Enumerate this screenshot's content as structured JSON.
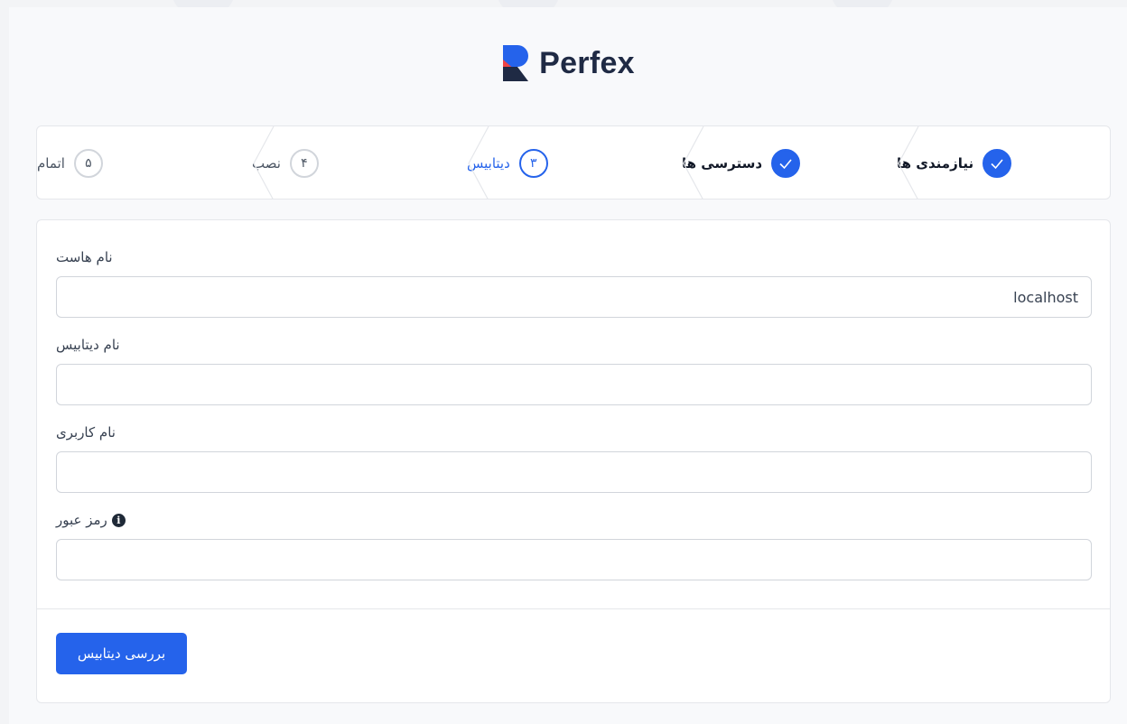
{
  "brand": {
    "name": "Perfex"
  },
  "steps": [
    {
      "number": "✓",
      "label": "نیازمندی ها",
      "state": "done"
    },
    {
      "number": "✓",
      "label": "دسترسی ها",
      "state": "done"
    },
    {
      "number": "۳",
      "label": "دیتابیس",
      "state": "active"
    },
    {
      "number": "۴",
      "label": "نصب",
      "state": "pending"
    },
    {
      "number": "۵",
      "label": "اتمام",
      "state": "pending"
    }
  ],
  "form": {
    "hostname": {
      "label": "نام هاست",
      "value": "localhost"
    },
    "database": {
      "label": "نام دیتابیس",
      "value": ""
    },
    "username": {
      "label": "نام کاربری",
      "value": ""
    },
    "password": {
      "label": "رمز عبور",
      "value": ""
    }
  },
  "actions": {
    "check_db_label": "بررسی دیتابیس"
  },
  "colors": {
    "accent": "#2563eb",
    "border": "#d1d5db"
  }
}
